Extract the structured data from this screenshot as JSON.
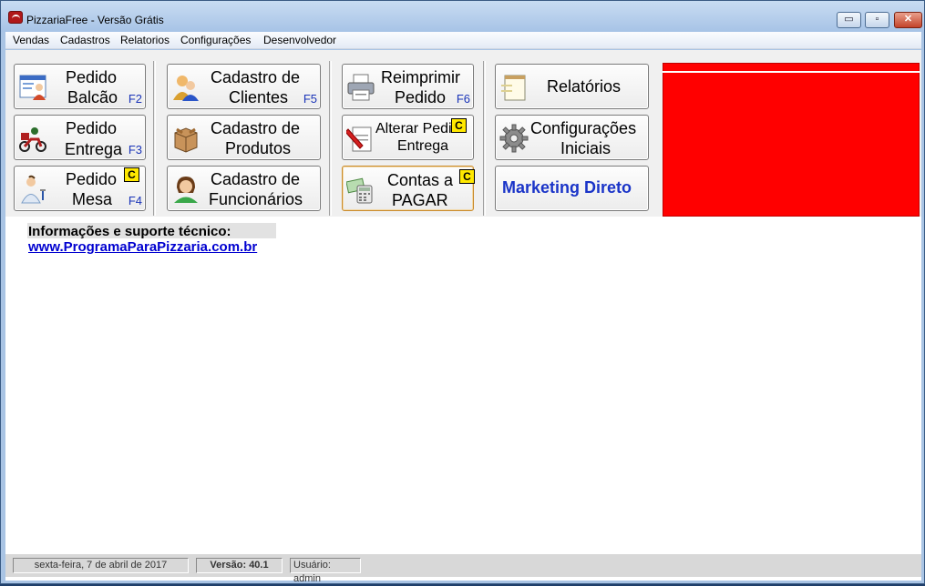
{
  "window": {
    "title": "PizzariaFree - Versão Grátis",
    "min_label": "▭",
    "max_label": "▫",
    "close_label": "✕"
  },
  "menu": [
    "Vendas",
    "Cadastros",
    "Relatorios",
    "Configurações",
    "Desenvolvedor"
  ],
  "buttons": {
    "pedido_balcao": {
      "line1": "Pedido",
      "line2": "Balcão",
      "key": "F2"
    },
    "pedido_entrega": {
      "line1": "Pedido",
      "line2": "Entrega",
      "key": "F3"
    },
    "pedido_mesa": {
      "line1": "Pedido",
      "line2": "Mesa",
      "key": "F4",
      "badge": "C"
    },
    "cadastro_clientes": {
      "line1": "Cadastro de",
      "line2": "Clientes",
      "key": "F5"
    },
    "cadastro_produtos": {
      "line1": "Cadastro de",
      "line2": "Produtos"
    },
    "cadastro_funcionarios": {
      "line1": "Cadastro de",
      "line2": "Funcionários"
    },
    "reimprimir_pedido": {
      "line1": "Reimprimir",
      "line2": "Pedido",
      "key": "F6"
    },
    "alterar_pedido": {
      "line1": "Alterar Pedi",
      "line2": "Entrega",
      "badge": "C"
    },
    "contas_pagar": {
      "line1": "Contas a",
      "line2": "PAGAR",
      "badge": "C"
    },
    "relatorios": {
      "line1": "Relatórios"
    },
    "configuracoes": {
      "line1": "Configurações",
      "line2": "Iniciais"
    },
    "marketing": {
      "line1": "Marketing Direto"
    }
  },
  "info": {
    "title": "Informações e suporte técnico:",
    "link": "www.ProgramaParaPizzaria.com.br"
  },
  "status": {
    "date": "sexta-feira, 7 de abril de 2017",
    "version": "Versão: 40.1",
    "user": "Usuário: admin"
  },
  "colors": {
    "badge": "#ffe800",
    "red_panel": "#ff0000",
    "link": "#0000d0",
    "key": "#1a34b8"
  }
}
